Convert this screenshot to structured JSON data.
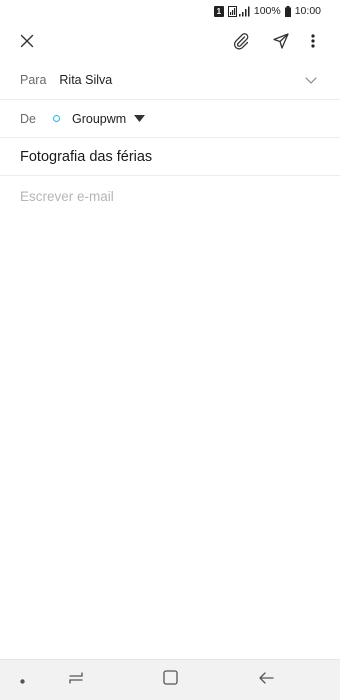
{
  "status_bar": {
    "sim": "1",
    "battery": "100%",
    "time": "10:00",
    "icons": [
      "sim-badge",
      "signal-icon",
      "battery-icon"
    ]
  },
  "toolbar": {
    "close_icon": "close-icon",
    "attach_icon": "paperclip-icon",
    "send_icon": "send-icon",
    "more_icon": "more-vertical-icon"
  },
  "compose": {
    "to_label": "Para",
    "to_value": "Rita Silva",
    "from_label": "De",
    "from_value": "Groupwm",
    "subject": "Fotografia das férias",
    "body_placeholder": "Escrever e-mail"
  },
  "colors": {
    "accent": "#29b6e8",
    "text": "#1f1f1f",
    "label": "#6b6b6b",
    "placeholder": "#b5b5b5"
  },
  "nav_bar": {
    "icons": [
      "dot-icon",
      "recent-apps-icon",
      "home-icon",
      "back-icon"
    ]
  }
}
